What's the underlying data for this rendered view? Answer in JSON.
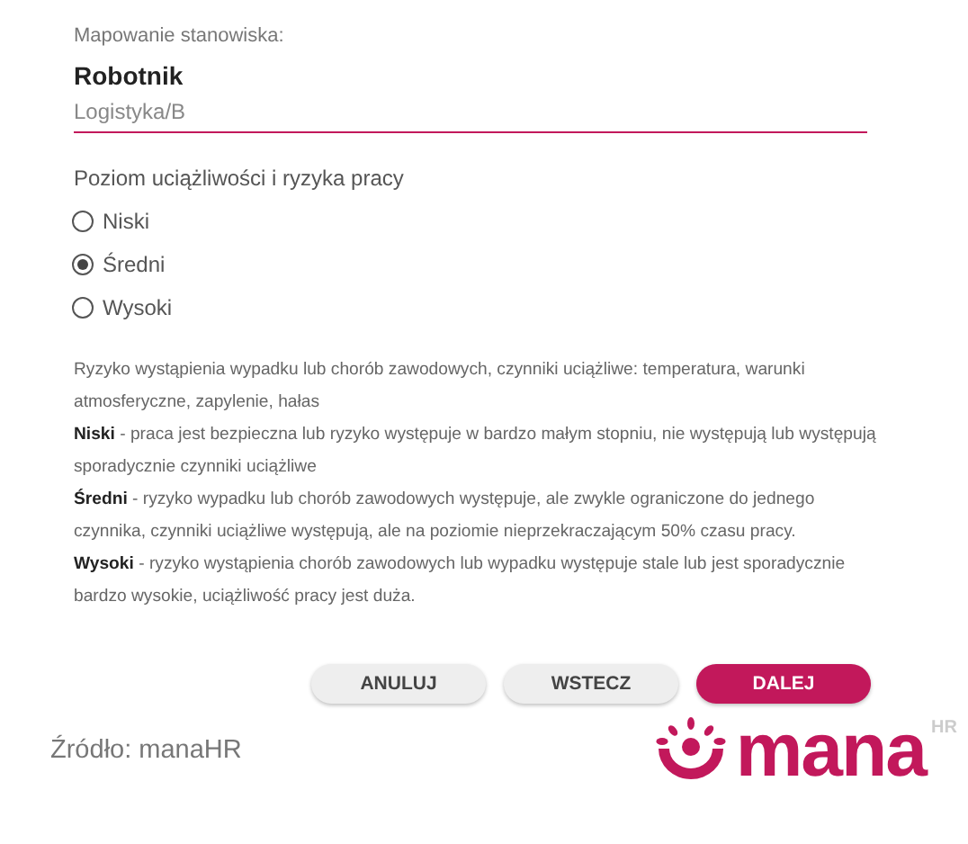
{
  "mapping": {
    "label": "Mapowanie stanowiska:",
    "title": "Robotnik",
    "value": "Logistyka/B"
  },
  "risk": {
    "label": "Poziom uciążliwości i ryzyka pracy",
    "options": [
      {
        "label": "Niski",
        "selected": false
      },
      {
        "label": "Średni",
        "selected": true
      },
      {
        "label": "Wysoki",
        "selected": false
      }
    ]
  },
  "description": [
    "Ryzyko wystąpienia wypadku lub chorób zawodowych, czynniki uciążliwe: temperatura, warunki atmosferyczne, zapylenie, hałas",
    "**Niski** - praca jest bezpieczna lub ryzyko występuje w bardzo małym stopniu, nie występują lub występują sporadycznie czynniki uciążliwe",
    "**Średni** - ryzyko wypadku lub chorób zawodowych występuje, ale zwykle ograniczone do jednego czynnika, czynniki uciążliwe występują, ale na poziomie nieprzekraczającym 50% czasu pracy.",
    "**Wysoki** - ryzyko wystąpienia chorób zawodowych lub wypadku występuje stale lub jest sporadycznie bardzo wysokie, uciążliwość pracy jest duża."
  ],
  "buttons": [
    {
      "label": "ANULUJ",
      "kind": "secondary"
    },
    {
      "label": "WSTECZ",
      "kind": "secondary"
    },
    {
      "label": "DALEJ",
      "kind": "primary"
    }
  ],
  "source": "Źródło: manaHR",
  "logo": {
    "name": "mana",
    "sup": "HR"
  }
}
